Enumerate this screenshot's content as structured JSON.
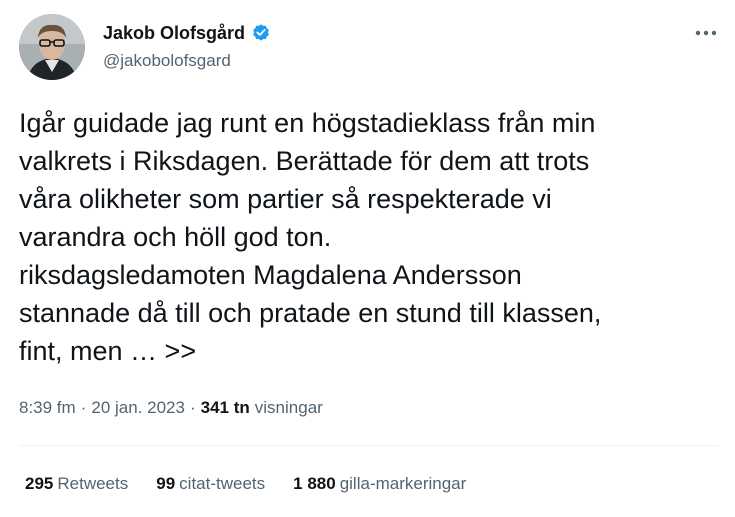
{
  "author": {
    "name": "Jakob Olofsgård",
    "handle": "@jakobolofsgard",
    "verified": true
  },
  "tweet": {
    "text": "Igår guidade jag runt en högstadieklass från min\nvalkrets i Riksdagen. Berättade för dem att trots\nvåra olikheter som partier så respekterade vi\nvarandra och höll god ton.\nriksdagsledamoten Magdalena Andersson\nstannade då till och pratade en stund till klassen,\nfint, men … >>"
  },
  "meta": {
    "time": "8:39 fm",
    "sep1": "·",
    "date": "20 jan. 2023",
    "sep2": "·",
    "views_count": "341 tn",
    "views_label": "visningar"
  },
  "stats": [
    {
      "count": "295",
      "label": "Retweets"
    },
    {
      "count": "99",
      "label": "citat-tweets"
    },
    {
      "count": "1 880",
      "label": "gilla-markeringar"
    }
  ],
  "icons": {
    "verified": "verified-badge-icon",
    "more": "more-horizontal-icon"
  },
  "colors": {
    "accent": "#1d9bf0",
    "text": "#0f1419",
    "secondary": "#536471",
    "divider": "#eff3f4"
  }
}
